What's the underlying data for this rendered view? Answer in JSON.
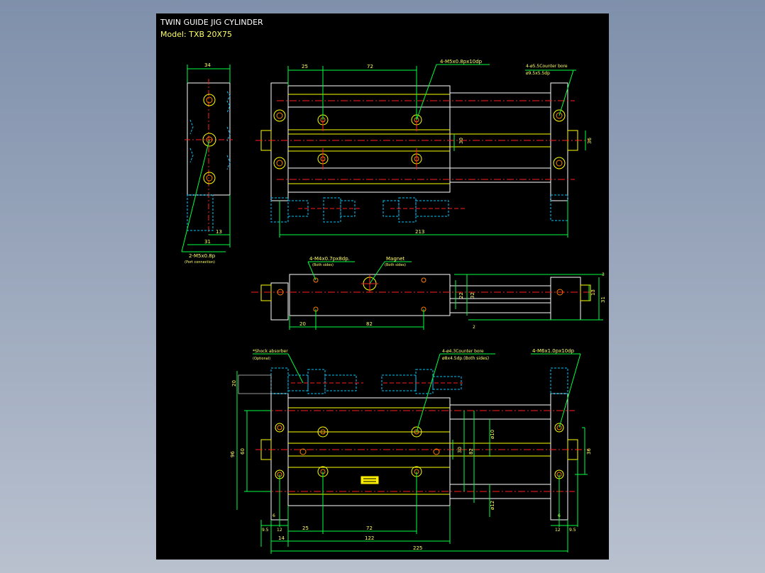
{
  "title": {
    "line1": "TWIN GUIDE JIG CYLINDER",
    "line2": "Model: TXB 20X75"
  },
  "top_view": {
    "dims": {
      "d25": "25",
      "d72": "72",
      "d213": "213",
      "d30": "30",
      "d36": "36"
    },
    "callouts": {
      "thread": "4-M5x0.8px10dp",
      "cbore1": "4-ø5.5Counter bore",
      "cbore2": "ø9.5x5.5dp"
    }
  },
  "end_view": {
    "dims": {
      "d34": "34",
      "d13": "13",
      "d31": "31"
    },
    "callouts": {
      "port": "2-M5x0.8p",
      "port_note": "(Port connection)"
    }
  },
  "side_view": {
    "dims": {
      "d20": "20",
      "d82": "82",
      "d22": "22",
      "d32": "32",
      "d13": "13",
      "d31": "31",
      "d3": "3",
      "d2": "2"
    },
    "callouts": {
      "m4": "4-M4x0.7px8dp.",
      "m4_note": "(Both sides)",
      "magnet": "Magnet",
      "magnet_note": "(Both sides)"
    }
  },
  "bottom_view": {
    "dims": {
      "d20": "20",
      "d96": "96",
      "d60": "60",
      "d30": "30",
      "d82": "82",
      "d10": "ø10",
      "d12": "ø12",
      "d36": "36",
      "d6a": "6",
      "d6b": "6",
      "d95a": "9.5",
      "d12a": "12",
      "d25": "25",
      "d72": "72",
      "d12b": "12",
      "d95b": "9.5",
      "d14": "14",
      "d122": "122",
      "d225": "225"
    },
    "callouts": {
      "shock1": "*Shock absorber",
      "shock2": "(Optional)",
      "cb1": "4-ø4.3Counter bore",
      "cb2": "ø8x4.5dp.(Both sides)",
      "m6": "4-M6x1.0px10dp"
    }
  }
}
